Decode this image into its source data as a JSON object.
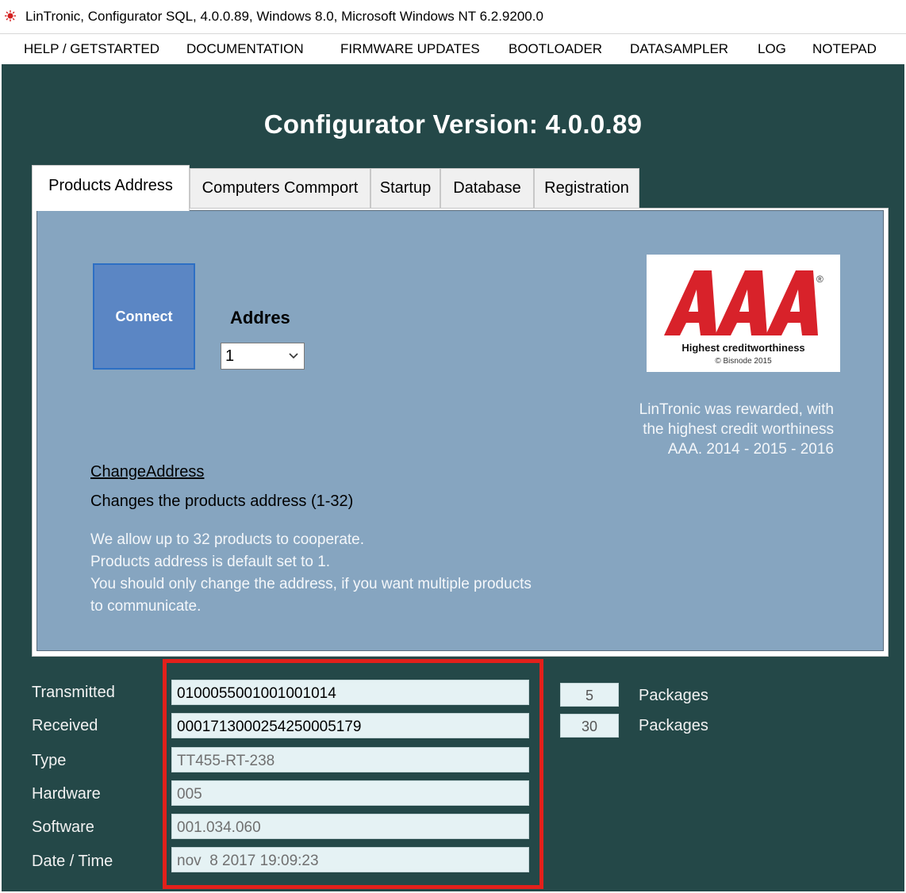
{
  "window": {
    "title": "LinTronic, Configurator SQL, 4.0.0.89, Windows 8.0, Microsoft Windows NT 6.2.9200.0"
  },
  "menu": [
    "HELP / GETSTARTED",
    "DOCUMENTATION",
    "FIRMWARE UPDATES",
    "BOOTLOADER",
    "DATASAMPLER",
    "LOG",
    "NOTEPAD"
  ],
  "headline": "Configurator Version: 4.0.0.89",
  "tabs": [
    "Products Address",
    "Computers Commport",
    "Startup",
    "Database",
    "Registration"
  ],
  "panel": {
    "connect_label": "Connect",
    "address_label": "Addres",
    "address_value": "1",
    "change_link": "ChangeAddress",
    "change_desc": "Changes the products address (1-32)",
    "info_lines": [
      "We allow up to 32 products to cooperate.",
      "Products address is default set to 1.",
      "You should only change the address, if you want multiple products",
      "to communicate."
    ],
    "badge": {
      "logo_text": "AAA",
      "registered": "®",
      "caption": "Highest creditworthiness",
      "copyright": "© Bisnode 2015"
    },
    "award_lines": [
      "LinTronic was rewarded, with",
      "the highest credit worthiness",
      "AAA. 2014 - 2015 - 2016"
    ]
  },
  "status": {
    "transmitted": {
      "label": "Transmitted",
      "value": "0100055001001001014",
      "count": "5",
      "unit": "Packages"
    },
    "received": {
      "label": "Received",
      "value": "0001713000254250005179",
      "count": "30",
      "unit": "Packages"
    },
    "type": {
      "label": "Type",
      "value": "TT455-RT-238"
    },
    "hardware": {
      "label": "Hardware",
      "value": "005"
    },
    "software": {
      "label": "Software",
      "value": "001.034.060"
    },
    "datetime": {
      "label": "Date / Time",
      "value": "nov  8 2017 19:09:23"
    }
  },
  "colors": {
    "background": "#244848",
    "panel": "#86a5c0",
    "connect_button": "#5b86c4",
    "aaa_red": "#d8222a",
    "highlight": "#e3201b"
  }
}
